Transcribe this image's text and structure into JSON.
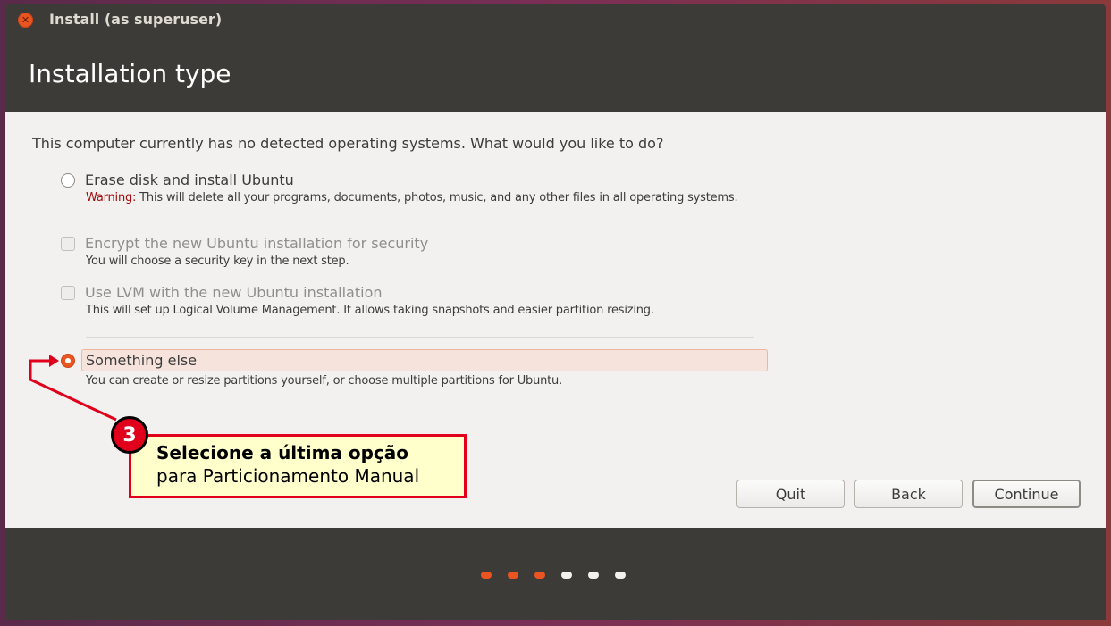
{
  "window": {
    "title": "Install (as superuser)"
  },
  "header": {
    "title": "Installation type"
  },
  "content": {
    "question": "This computer currently has no detected operating systems. What would you like to do?",
    "options": [
      {
        "label": "Erase disk and install Ubuntu",
        "warning_label": "Warning:",
        "description": " This will delete all your programs, documents, photos, music, and any other files in all operating systems.",
        "type": "radio",
        "checked": false
      },
      {
        "label": "Encrypt the new Ubuntu installation for security",
        "description": "You will choose a security key in the next step.",
        "type": "checkbox",
        "enabled": false
      },
      {
        "label": "Use LVM with the new Ubuntu installation",
        "description": "This will set up Logical Volume Management. It allows taking snapshots and easier partition resizing.",
        "type": "checkbox",
        "enabled": false
      },
      {
        "label": "Something else",
        "description": "You can create or resize partitions yourself, or choose multiple partitions for Ubuntu.",
        "type": "radio",
        "checked": true
      }
    ]
  },
  "buttons": {
    "quit": "Quit",
    "back": "Back",
    "continue": "Continue"
  },
  "progress": {
    "total_steps": 6,
    "completed_steps": 3
  },
  "annotation": {
    "badge": "3",
    "line1": "Selecione a última opção",
    "line2": "para Particionamento Manual"
  },
  "colors": {
    "accent": "#e95420",
    "annotation_red": "#e0001b",
    "annotation_bg": "#ffffcc"
  }
}
